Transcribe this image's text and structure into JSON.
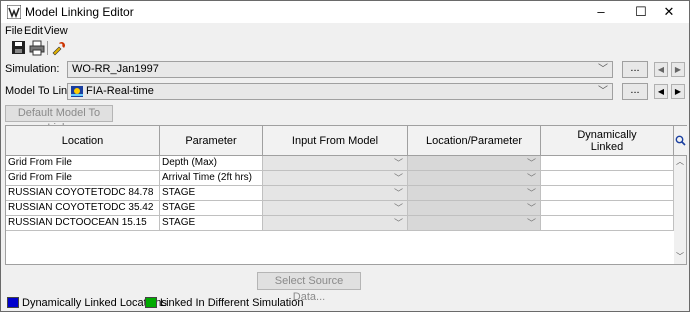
{
  "window": {
    "title": "Model Linking Editor",
    "controls": {
      "minimize": "–",
      "maximize": "☐",
      "close": "✕"
    }
  },
  "menu": [
    "File",
    "Edit",
    "View"
  ],
  "toolbar": {
    "icons": [
      "save-icon",
      "print-icon",
      "link-edit-icon"
    ]
  },
  "simulation": {
    "label": "Simulation:",
    "value": "WO-RR_Jan1997",
    "more": "..."
  },
  "model_to_link": {
    "label": "Model To Link:",
    "value": "FIA-Real-time",
    "more": "..."
  },
  "default_model_button": "Default Model To Link:",
  "table": {
    "headers": [
      "Location",
      "Parameter",
      "Input From Model",
      "Location/Parameter",
      "Dynamically Linked"
    ],
    "rows": [
      {
        "location": "Grid From File",
        "parameter": "Depth (Max)"
      },
      {
        "location": "Grid From File",
        "parameter": "Arrival Time (2ft hrs)"
      },
      {
        "location": "RUSSIAN COYOTETODC 84.78",
        "parameter": "STAGE"
      },
      {
        "location": "RUSSIAN COYOTETODC 35.42",
        "parameter": "STAGE"
      },
      {
        "location": "RUSSIAN DCTOOCEAN 15.15",
        "parameter": "STAGE"
      }
    ]
  },
  "select_source_button": "Select Source Data...",
  "legend": [
    {
      "label": "Dynamically Linked Locations",
      "color": "#0000cc"
    },
    {
      "label": "Linked In Different Simulation",
      "color": "#00aa00"
    }
  ]
}
